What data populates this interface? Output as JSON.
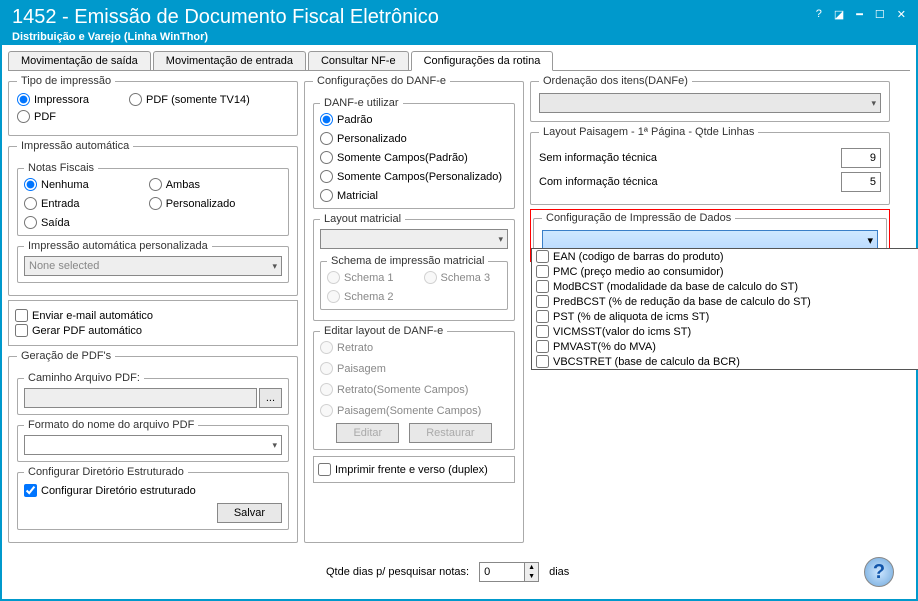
{
  "titlebar": {
    "title": "1452 - Emissão de Documento Fiscal Eletrônico",
    "subtitle": "Distribuição e Varejo (Linha WinThor)"
  },
  "tabs": {
    "t0": "Movimentação de saída",
    "t1": "Movimentação de entrada",
    "t2": "Consultar NF-e",
    "t3": "Configurações da rotina"
  },
  "tipo_impressao": {
    "legend": "Tipo de impressão",
    "r0": "Impressora",
    "r1": "PDF (somente TV14)",
    "r2": "PDF"
  },
  "auto": {
    "legend": "Impressão automática",
    "nf_legend": "Notas Fiscais",
    "r0": "Nenhuma",
    "r1": "Ambas",
    "r2": "Entrada",
    "r3": "Personalizado",
    "r4": "Saída",
    "pers_legend": "Impressão automática personalizada",
    "pers_placeholder": "None selected"
  },
  "email": {
    "c0": "Enviar e-mail automático",
    "c1": "Gerar PDF automático"
  },
  "pdf": {
    "legend": "Geração de PDF's",
    "caminho_legend": "Caminho Arquivo PDF:",
    "formato_legend": "Formato do nome do arquivo PDF",
    "dir_legend": "Configurar Diretório Estruturado",
    "dir_check": "Configurar Diretório estruturado",
    "salvar": "Salvar"
  },
  "danfe": {
    "legend": "Configurações do DANF-e",
    "util_legend": "DANF-e utilizar",
    "r0": "Padrão",
    "r1": "Personalizado",
    "r2": "Somente Campos(Padrão)",
    "r3": "Somente Campos(Personalizado)",
    "r4": "Matricial",
    "matricial_legend": "Layout matricial",
    "schema_legend": "Schema de impressão matricial",
    "s1": "Schema 1",
    "s2": "Schema 2",
    "s3": "Schema 3",
    "edit_legend": "Editar layout de DANF-e",
    "e0": "Retrato",
    "e1": "Paisagem",
    "e2": "Retrato(Somente Campos)",
    "e3": "Paisagem(Somente Campos)",
    "btn_edit": "Editar",
    "btn_rest": "Restaurar",
    "duplex": "Imprimir frente e verso (duplex)"
  },
  "ordenacao": {
    "legend": "Ordenação dos itens(DANFe)"
  },
  "layout_paisagem": {
    "legend": "Layout Paisagem - 1ª Página - Qtde Linhas",
    "sem": "Sem informação técnica",
    "sem_v": "9",
    "com": "Com informação técnica",
    "com_v": "5"
  },
  "config_dados": {
    "legend": "Configuração de Impressão de Dados",
    "items": {
      "i0": "EAN (codigo de barras do produto)",
      "i1": "PMC (preço medio ao consumidor)",
      "i2": "ModBCST (modalidade da base de calculo do ST)",
      "i3": "PredBCST (% de redução da base de calculo do ST)",
      "i4": "PST (% de aliquota de icms ST)",
      "i5": "VICMSST(valor do icms ST)",
      "i6": "PMVAST(% do MVA)",
      "i7": "VBCSTRET (base de calculo da BCR)"
    }
  },
  "bottom": {
    "label": "Qtde dias p/ pesquisar notas:",
    "value": "0",
    "unit": "dias"
  }
}
